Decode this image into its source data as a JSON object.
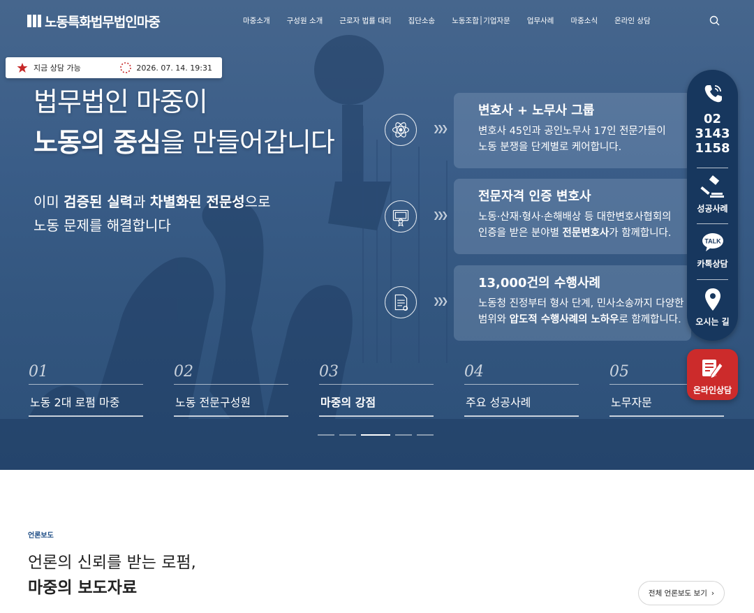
{
  "header": {
    "logo_text": "노동특화법무법인마중",
    "nav": [
      "마중소개",
      "구성원 소개",
      "근로자 법률 대리",
      "집단소송",
      "노동조합│기업자문",
      "업무사례",
      "마중소식",
      "온라인 상담"
    ],
    "search_icon": "search-icon"
  },
  "status_bar": {
    "availability": "지금 상담 가능",
    "datetime": "2026. 07. 14. 19:31"
  },
  "hero": {
    "headline_line1": "법무법인 마중이",
    "headline_line2_bold1": "노동의 중심",
    "headline_line2_rest": "을 만들어갑니다",
    "sub_line1_a": "이미 ",
    "sub_line1_b": "검증된 실력",
    "sub_line1_c": "과 ",
    "sub_line1_d": "차별화된 전문성",
    "sub_line1_e": "으로",
    "sub_line2": "노동 문제를 해결합니다"
  },
  "features": [
    {
      "icon": "atom-icon",
      "title": "변호사 + 노무사 그룹",
      "desc1": "변호사 45인과 공인노무사 17인 전문가들이",
      "desc2": "노동 분쟁을 단계별로 케어합니다."
    },
    {
      "icon": "certificate-icon",
      "title": "전문자격 인증 변호사",
      "desc1": "노동·산재·형사·손해배상 등 대한변호사협회의",
      "desc2a": "인증을 받은 분야별 ",
      "desc2b": "전문변호사",
      "desc2c": "가 함께합니다."
    },
    {
      "icon": "document-icon",
      "title": "13,000건의 수행사례",
      "desc1": "노동청 진정부터 형사 단계, 민사소송까지 다양한",
      "desc2a": "범위와 ",
      "desc2b": "압도적 수행사례의 노하우",
      "desc2c": "로 함께합니다."
    }
  ],
  "tabs": [
    {
      "num": "01",
      "label": "노동 2대 로펌 마중"
    },
    {
      "num": "02",
      "label": "노동 전문구성원"
    },
    {
      "num": "03",
      "label": "마중의 강점",
      "active": true
    },
    {
      "num": "04",
      "label": "주요 성공사례"
    },
    {
      "num": "05",
      "label": "노무자문"
    }
  ],
  "slider": {
    "count": 5,
    "active": 3
  },
  "sidebar": {
    "phone_lines": [
      "02",
      "3143",
      "1158"
    ],
    "success": "성공사례",
    "kakao": "카톡상담",
    "kakao_badge": "TALK",
    "directions": "오시는 길",
    "online": "온라인상담"
  },
  "press": {
    "tag": "언론보도",
    "title_line1": "언론의 신뢰를 받는 로펌,",
    "title_line2": "마중의 보도자료",
    "button": "전체 언론보도 보기",
    "button_arrow": "›"
  },
  "colors": {
    "hero_blue": "#33567f",
    "sidebar_navy": "#17375e",
    "online_red": "#cc2b2b",
    "accent_blue": "#1f4e86"
  }
}
